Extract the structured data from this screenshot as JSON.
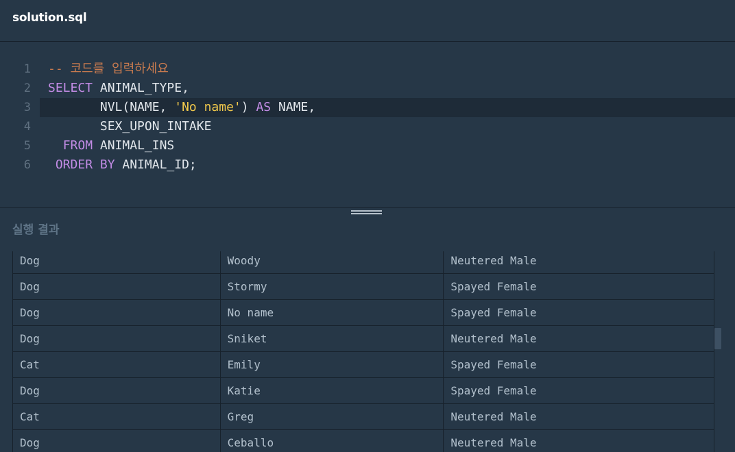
{
  "header": {
    "file_name": "solution.sql"
  },
  "editor": {
    "lines": [
      {
        "num": "1",
        "tokens": [
          {
            "t": "-- 코드를 입력하세요",
            "k": "comment"
          }
        ]
      },
      {
        "num": "2",
        "tokens": [
          {
            "t": "SELECT",
            "k": "kw"
          },
          {
            "t": " ANIMAL_TYPE,",
            "k": "id"
          }
        ]
      },
      {
        "num": "3",
        "tokens": [
          {
            "t": "       NVL(NAME, ",
            "k": "id"
          },
          {
            "t": "'No name'",
            "k": "str"
          },
          {
            "t": ") ",
            "k": "id"
          },
          {
            "t": "AS",
            "k": "kw"
          },
          {
            "t": " NAME,",
            "k": "id"
          }
        ]
      },
      {
        "num": "4",
        "tokens": [
          {
            "t": "       SEX_UPON_INTAKE",
            "k": "id"
          }
        ]
      },
      {
        "num": "5",
        "tokens": [
          {
            "t": "  ",
            "k": "id"
          },
          {
            "t": "FROM",
            "k": "kw"
          },
          {
            "t": " ANIMAL_INS",
            "k": "id"
          }
        ]
      },
      {
        "num": "6",
        "tokens": [
          {
            "t": " ",
            "k": "id"
          },
          {
            "t": "ORDER BY",
            "k": "kw"
          },
          {
            "t": " ANIMAL_ID;",
            "k": "id"
          }
        ]
      }
    ],
    "active_line": 3
  },
  "results": {
    "title": "실행 결과",
    "rows": [
      [
        "Dog",
        "Woody",
        "Neutered Male"
      ],
      [
        "Dog",
        "Stormy",
        "Spayed Female"
      ],
      [
        "Dog",
        "No name",
        "Spayed Female"
      ],
      [
        "Dog",
        "Sniket",
        "Neutered Male"
      ],
      [
        "Cat",
        "Emily",
        "Spayed Female"
      ],
      [
        "Dog",
        "Katie",
        "Spayed Female"
      ],
      [
        "Cat",
        "Greg",
        "Neutered Male"
      ],
      [
        "Dog",
        "Ceballo",
        "Neutered Male"
      ]
    ]
  }
}
